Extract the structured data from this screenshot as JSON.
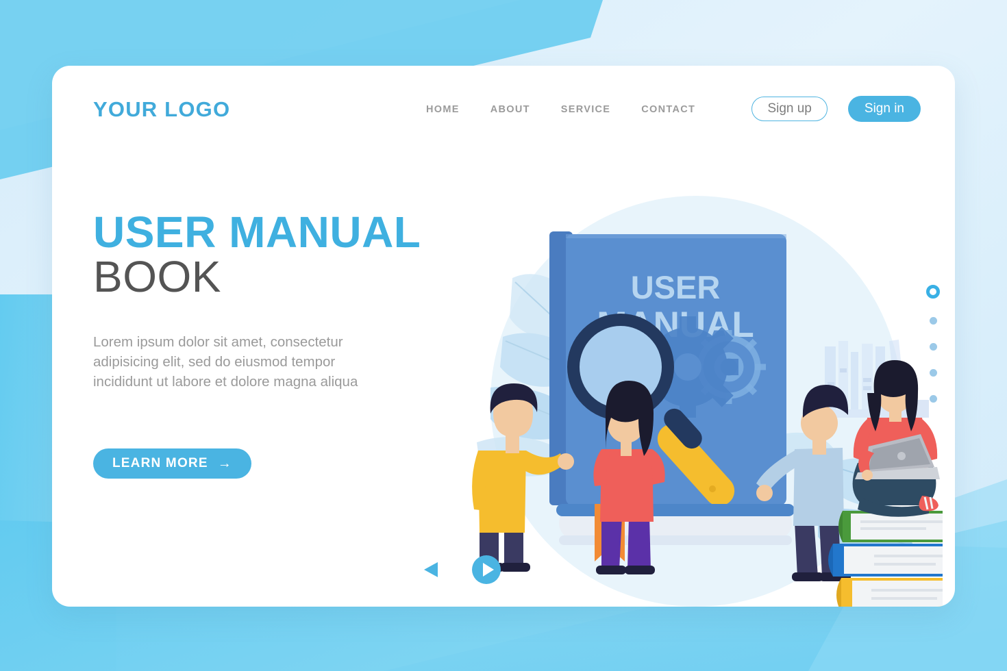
{
  "colors": {
    "accent": "#4ab4e2",
    "accent_dark": "#3fb0e0",
    "heading_dark": "#545454",
    "body_text": "#9a9a9a",
    "nav_text": "#9b9b9b",
    "page_bg": "#cfe9f8",
    "bg_shape_blue": "#6fcdf0",
    "card_bg": "#ffffff",
    "book_cover": "#5a8fd0",
    "book_spine": "#4a7cc0",
    "magnifier_ring": "#23395f",
    "magnifier_handle": "#f5bd2e",
    "bookmark_orange": "#f28b35"
  },
  "header": {
    "logo": "YOUR LOGO",
    "nav": [
      {
        "label": "HOME"
      },
      {
        "label": "ABOUT"
      },
      {
        "label": "SERVICE"
      },
      {
        "label": "CONTACT"
      }
    ],
    "sign_up_label": "Sign up",
    "sign_in_label": "Sign in"
  },
  "hero": {
    "title_line1": "USER MANUAL",
    "title_line2": "BOOK",
    "paragraph": "Lorem ipsum dolor sit amet, consectetur adipisicing elit, sed do eiusmod tempor incididunt ut labore et dolore magna aliqua",
    "cta_label": "LEARN MORE",
    "cta_icon": "arrow-right-icon",
    "cta_arrow": "→"
  },
  "illustration": {
    "book_cover_line1": "USER",
    "book_cover_line2": "MANUAL",
    "elements": [
      "magnifying-glass-icon",
      "gear-icon",
      "bookmark-icon",
      "bookshelf-icon",
      "leaf-decoration",
      "book-stack",
      "person-standing-yellow",
      "person-standing-coral",
      "person-standing-blue",
      "person-seated-laptop"
    ]
  },
  "carousel": {
    "dots": [
      {
        "label": "slide-1",
        "active": true
      },
      {
        "label": "slide-2",
        "active": false
      },
      {
        "label": "slide-3",
        "active": false
      },
      {
        "label": "slide-4",
        "active": false
      },
      {
        "label": "slide-5",
        "active": false
      }
    ],
    "prev_icon": "triangle-left-icon",
    "next_icon": "play-circle-icon"
  }
}
